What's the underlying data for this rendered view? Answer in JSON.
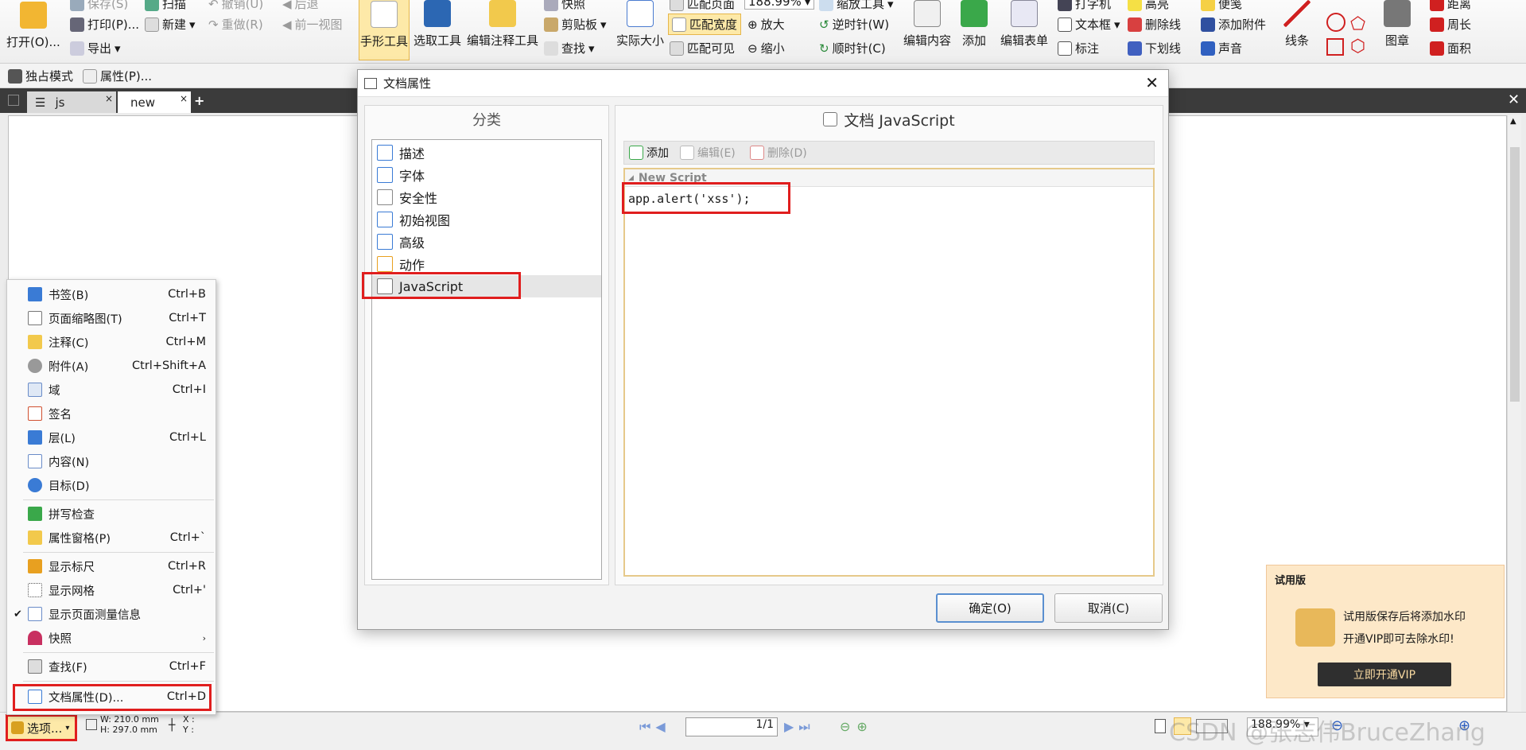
{
  "ribbon": {
    "open": "打开(O)...",
    "save": "保存(S)",
    "print": "打印(P)...",
    "export": "导出",
    "scan": "扫描",
    "new": "新建",
    "undo": "撤销(U)",
    "redo": "重做(R)",
    "back": "后退",
    "prev_view": "前一视图",
    "hand_tool": "手形工具",
    "select_tool": "选取工具",
    "edit_annot_tool": "编辑注释工具",
    "snapshot": "快照",
    "clipboard": "剪贴板",
    "find": "查找",
    "actual_size": "实际大小",
    "fit_page": "匹配页面",
    "fit_width": "匹配宽度",
    "fit_visible": "匹配可见",
    "zoom_value": "188.99%",
    "zoom_in": "放大",
    "zoom_out": "缩小",
    "zoom_tool": "缩放工具",
    "rotate_ccw": "逆时针(W)",
    "rotate_cw": "顺时针(C)",
    "edit_content": "编辑内容",
    "add": "添加",
    "edit_form": "编辑表单",
    "typewriter": "打字机",
    "textbox": "文本框",
    "callout": "标注",
    "highlight": "高亮",
    "strikeout": "删除线",
    "underline": "下划线",
    "note": "便笺",
    "attach_file": "添加附件",
    "sound": "声音",
    "line": "线条",
    "stamp": "图章",
    "distance": "距离",
    "perimeter": "周长",
    "area": "面积"
  },
  "toolbar2": {
    "exclusive_mode": "独占模式",
    "properties": "属性(P)..."
  },
  "tabs": [
    {
      "label": "js"
    },
    {
      "label": "new"
    }
  ],
  "menu": {
    "items": [
      {
        "label": "书签(B)",
        "shortcut": "Ctrl+B",
        "icon": "bookmark-icon"
      },
      {
        "label": "页面缩略图(T)",
        "shortcut": "Ctrl+T",
        "icon": "thumbnails-icon"
      },
      {
        "label": "注释(C)",
        "shortcut": "Ctrl+M",
        "icon": "comment-icon"
      },
      {
        "label": "附件(A)",
        "shortcut": "Ctrl+Shift+A",
        "icon": "paperclip-icon"
      },
      {
        "label": "域",
        "shortcut": "Ctrl+I",
        "icon": "field-icon"
      },
      {
        "label": "签名",
        "shortcut": "",
        "icon": "signature-icon"
      },
      {
        "label": "层(L)",
        "shortcut": "Ctrl+L",
        "icon": "layers-icon"
      },
      {
        "label": "内容(N)",
        "shortcut": "",
        "icon": "content-icon"
      },
      {
        "label": "目标(D)",
        "shortcut": "",
        "icon": "target-icon"
      },
      {
        "label": "拼写检查",
        "shortcut": "",
        "icon": "spellcheck-icon"
      },
      {
        "label": "属性窗格(P)",
        "shortcut": "Ctrl+`",
        "icon": "properties-pane-icon"
      },
      {
        "label": "显示标尺",
        "shortcut": "Ctrl+R",
        "icon": "ruler-icon"
      },
      {
        "label": "显示网格",
        "shortcut": "Ctrl+'",
        "icon": "grid-icon"
      },
      {
        "label": "显示页面测量信息",
        "shortcut": "",
        "icon": "measure-icon"
      },
      {
        "label": "快照",
        "shortcut": "",
        "icon": "magnet-icon"
      },
      {
        "label": "查找(F)",
        "shortcut": "Ctrl+F",
        "icon": "find-icon"
      },
      {
        "label": "文档属性(D)...",
        "shortcut": "Ctrl+D",
        "icon": "doc-properties-icon"
      }
    ]
  },
  "dialog": {
    "title": "文档属性",
    "category_header": "分类",
    "categories": [
      "描述",
      "字体",
      "安全性",
      "初始视图",
      "高级",
      "动作",
      "JavaScript"
    ],
    "section_title": "文档 JavaScript",
    "add_label": "添加",
    "edit_label": "编辑(E)",
    "delete_label": "删除(D)",
    "script_name": "New Script",
    "script_code": "app.alert('xss');",
    "ok_label": "确定(O)",
    "cancel_label": "取消(C)"
  },
  "statusbar": {
    "options_label": "选项...",
    "width": "W: 210.0 mm",
    "height": "H: 297.0 mm",
    "x_label": "X :",
    "y_label": "Y :",
    "page_indicator": "1/1",
    "zoom": "188.99%"
  },
  "trial": {
    "title": "试用版",
    "line1": "试用版保存后将添加水印",
    "line2": "开通VIP即可去除水印!",
    "button": "立即开通VIP"
  },
  "watermark": "CSDN @张志伟BruceZhang",
  "colors": {
    "highlight_red": "#e01e1e",
    "selected_yellow": "#fde9a8",
    "tab_dark": "#3b3b3b",
    "vip_button": "#2f2f2f",
    "trial_bg": "#fde8c8"
  }
}
